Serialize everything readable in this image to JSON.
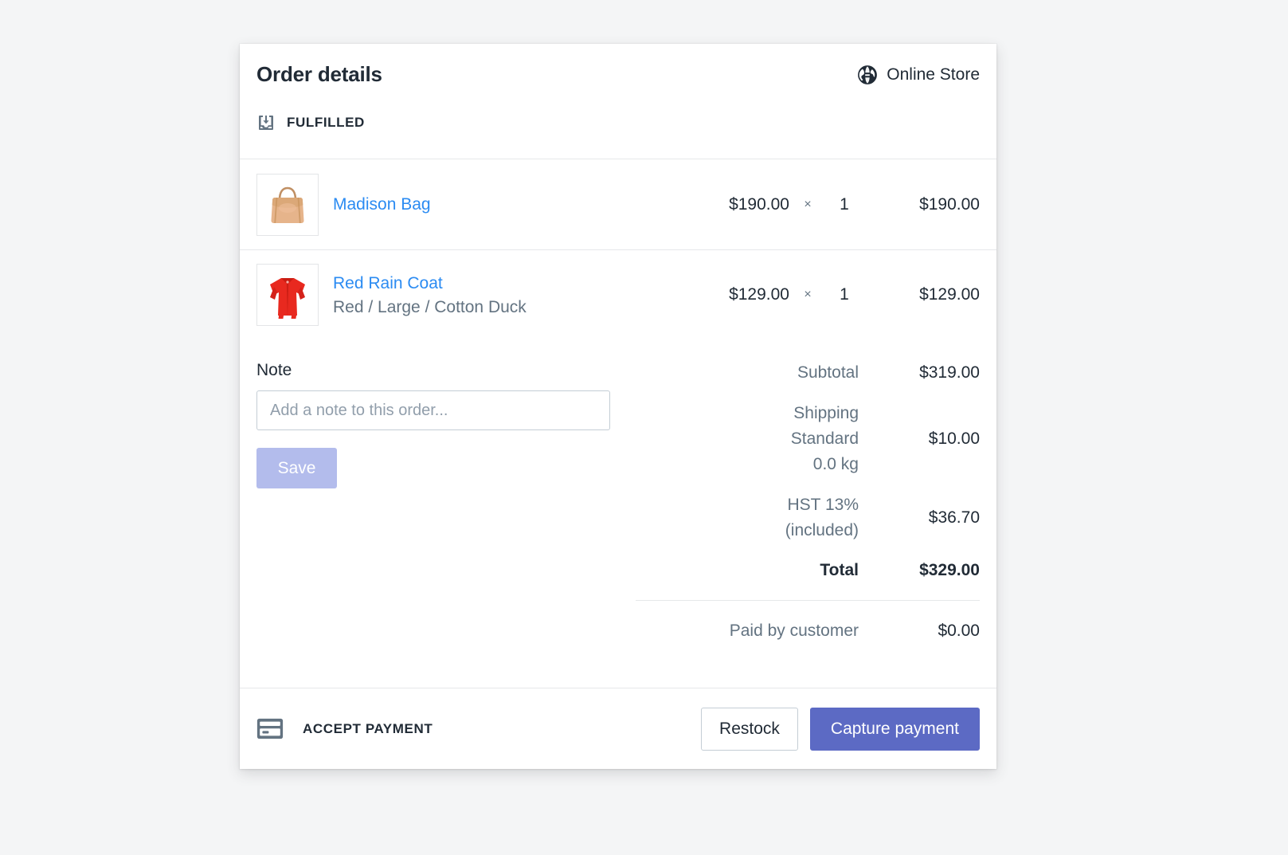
{
  "header": {
    "title": "Order details",
    "channel_icon": "globe-icon",
    "channel_label": "Online Store",
    "fulfillment_icon": "fulfilled-tray-icon",
    "fulfillment_status": "FULFILLED"
  },
  "line_items": [
    {
      "thumbnail": "tote-bag-image",
      "name": "Madison Bag",
      "variant": "",
      "price": "$190.00",
      "multiply": "×",
      "quantity": "1",
      "line_total": "$190.00"
    },
    {
      "thumbnail": "red-rain-coat-image",
      "name": "Red Rain Coat",
      "variant": "Red / Large / Cotton Duck",
      "price": "$129.00",
      "multiply": "×",
      "quantity": "1",
      "line_total": "$129.00"
    }
  ],
  "note": {
    "label": "Note",
    "value": "",
    "placeholder": "Add a note to this order...",
    "save_label": "Save"
  },
  "totals": {
    "subtotal_label": "Subtotal",
    "subtotal_value": "$319.00",
    "shipping_label": "Shipping",
    "shipping_method": "Standard",
    "shipping_weight": "0.0 kg",
    "shipping_value": "$10.00",
    "tax_label": "HST 13%",
    "tax_note": "(included)",
    "tax_value": "$36.70",
    "total_label": "Total",
    "total_value": "$329.00",
    "paid_label": "Paid by customer",
    "paid_value": "$0.00"
  },
  "footer": {
    "payment_icon": "credit-card-icon",
    "accept_label": "ACCEPT PAYMENT",
    "restock_label": "Restock",
    "capture_label": "Capture payment"
  },
  "colors": {
    "link": "#2b8bf2",
    "primary_button": "#5c6ac4",
    "save_button_disabled": "#b3bcec",
    "text": "#212b36",
    "muted_text": "#637381",
    "border": "#e6e8ea",
    "page_background": "#f4f5f6"
  }
}
